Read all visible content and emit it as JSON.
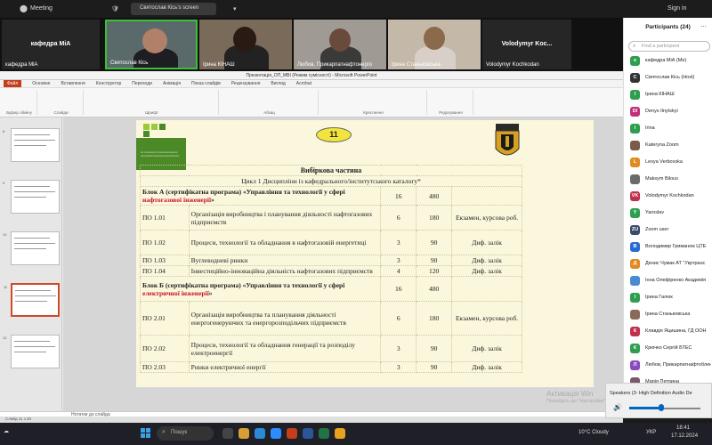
{
  "topbar": {
    "app": "Meeting",
    "share_label": "Святослав Кісь's screen",
    "signin": "Sign in"
  },
  "tiles": [
    {
      "big": "кафедра МіА",
      "name": "кафедра МіА"
    },
    {
      "big": "",
      "name": "Святослав Кісь"
    },
    {
      "big": "",
      "name": "Ірина КІНАШ"
    },
    {
      "big": "",
      "name": "Любов, Прикарпатнафтонерго"
    },
    {
      "big": "",
      "name": "Ірина Станьковська"
    },
    {
      "big": "Volodymyr Koc...",
      "name": "Volodymyr Kochkodan"
    }
  ],
  "ppt": {
    "title": "Презентація_ОП_МВІ (Режим сумісності) - Microsoft PowerPoint",
    "tabs": [
      "Основне",
      "Вставлення",
      "Конструктор",
      "Переходи",
      "Анімація",
      "Показ слайдів",
      "Рецензування",
      "Вигляд",
      "Acrobat"
    ],
    "ribbon_groups": [
      "Буфер обміну",
      "Слайди",
      "Шрифт",
      "Абзац",
      "Креслення",
      "Редагування"
    ],
    "notes_placeholder": "Нотатки до слайда",
    "status": "Слайд 11 з 25"
  },
  "slide": {
    "page_number": "11",
    "heading": "Вибіркова частина",
    "subheading": "Цикл 1 Дисципліни із кафедрального/інститутського каталогу*",
    "block_a": {
      "text_1": "Блок А (сертифікатна програма) «Управління та технології у сфері ",
      "red": "нафтогазової інженерії",
      "text_2": "»",
      "credits": "16",
      "hours": "480"
    },
    "block_a_rows": [
      {
        "code": "ПО 1.01",
        "name": "Організація виробництва і планування діяльності нафтогазових підприємств",
        "credits": "6",
        "hours": "180",
        "control": "Екзамен, курсова роб."
      },
      {
        "code": "ПО 1.02",
        "name": "Процеси, технології та обладнання в нафтогазовій енергетиці",
        "credits": "3",
        "hours": "90",
        "control": "Диф. залік"
      },
      {
        "code": "ПО 1.03",
        "name": "Вуглеводневі ринки",
        "credits": "3",
        "hours": "90",
        "control": "Диф. залік"
      },
      {
        "code": "ПО 1.04",
        "name": "Інвестиційно-інноваційна діяльність нафтогазових підприємств",
        "credits": "4",
        "hours": "120",
        "control": "Диф. залік"
      }
    ],
    "block_b": {
      "text_1": "Блок Б (сертифікатна програма) «Управління та технології у сфері ",
      "red": "електричної інженерії",
      "text_2": "»",
      "credits": "16",
      "hours": "480"
    },
    "block_b_rows": [
      {
        "code": "ПО 2.01",
        "name": "Організація виробництва та планування діяльності енергогенеруючих та енергорозподільчих підприємств",
        "credits": "6",
        "hours": "180",
        "control": "Екзамен, курсова роб."
      },
      {
        "code": "ПО 2.02",
        "name": "Процеси, технології та обладнання генерації та розподілу електроенергії",
        "credits": "3",
        "hours": "90",
        "control": "Диф. залік"
      },
      {
        "code": "ПО 2.03",
        "name": "Ринки електричної енергії",
        "credits": "3",
        "hours": "90",
        "control": "Диф. залік"
      }
    ]
  },
  "panel": {
    "title": "Participants (24)",
    "search_placeholder": "Find a participant",
    "participants": [
      {
        "initials": "к",
        "color": "#2e9e4f",
        "name": "кафедра МіА (Me)"
      },
      {
        "initials": "С",
        "color": "#333333",
        "name": "Святослав Кісь (Host)"
      },
      {
        "initials": "І",
        "color": "#2e9e4f",
        "name": "Ірина КІНАШ"
      },
      {
        "initials": "DI",
        "color": "#c0307a",
        "name": "Denys Ilnytskyi"
      },
      {
        "initials": "I",
        "color": "#2e9e4f",
        "name": "Irina"
      },
      {
        "initials": "",
        "color": "#7a5a4a",
        "name": "Kateryna Zoom"
      },
      {
        "initials": "L",
        "color": "#e08a20",
        "name": "Lesya Verbovska"
      },
      {
        "initials": "",
        "color": "#6a6a6a",
        "name": "Maksym Bilous"
      },
      {
        "initials": "VK",
        "color": "#c0304a",
        "name": "Volodymyr Kochkodan"
      },
      {
        "initials": "Y",
        "color": "#2e9e4f",
        "name": "Yaroslav"
      },
      {
        "initials": "ZU",
        "color": "#3a4a6a",
        "name": "Zoom user"
      },
      {
        "initials": "В",
        "color": "#2a6ad0",
        "name": "Володимир Гриманюк ЦТЕ"
      },
      {
        "initials": "Д",
        "color": "#e08a20",
        "name": "Денис Чумак АТ \"Укртранс"
      },
      {
        "initials": "",
        "color": "#4a8ad0",
        "name": "Інна Олефіренко Академія"
      },
      {
        "initials": "І",
        "color": "#2e9e4f",
        "name": "Ірина Галюк"
      },
      {
        "initials": "",
        "color": "#8a6a5a",
        "name": "Ірина Станьковська"
      },
      {
        "initials": "К",
        "color": "#c0304a",
        "name": "Клавдія Яцишина, ГД ООН"
      },
      {
        "initials": "К",
        "color": "#2e9e4f",
        "name": "Крючко Сергій БТЕС"
      },
      {
        "initials": "Л",
        "color": "#8a4ac0",
        "name": "Любов, Прикарпатнафтоблен"
      },
      {
        "initials": "",
        "color": "#7a5a6a",
        "name": "Марія Петрина"
      }
    ]
  },
  "audio": {
    "label": "Speakers (3- High Definition Audio De",
    "volume_percent": 45
  },
  "activation": {
    "line1": "Активація Win",
    "line2": "Перейдіть до \"Настройки\", щоб активувати Windo"
  },
  "taskbar": {
    "search": "Пошук",
    "weather": "10°C  Cloudy",
    "lang": "УКР",
    "time": "18:41",
    "date": "17.12.2024"
  }
}
